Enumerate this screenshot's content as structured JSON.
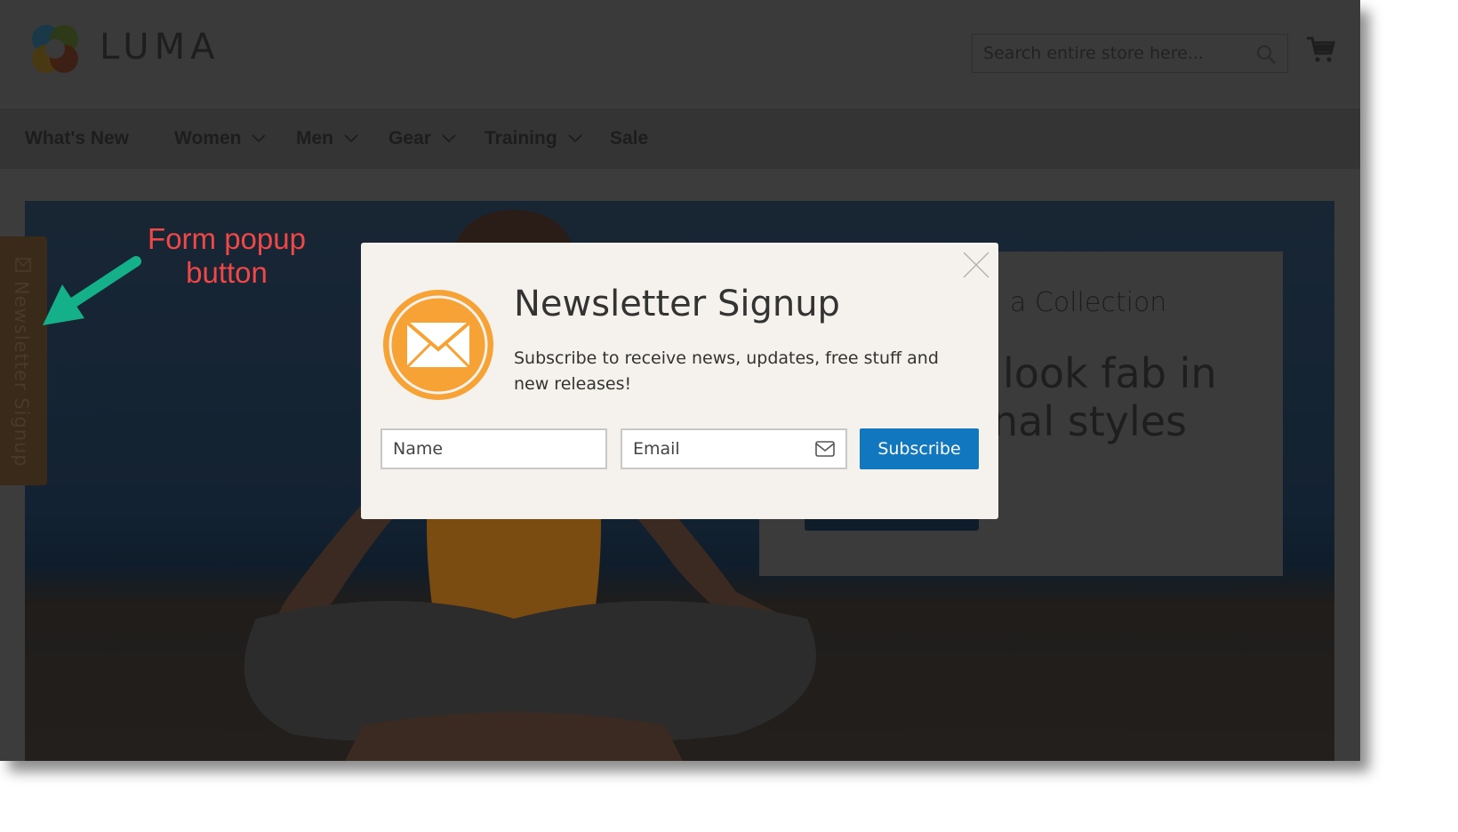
{
  "header": {
    "logo_text": "LUMA",
    "search": {
      "placeholder": "Search entire store here..."
    },
    "icons": {
      "search": "search-icon",
      "cart": "cart-icon"
    }
  },
  "nav": {
    "items": [
      {
        "label": "What's New",
        "has_dropdown": false
      },
      {
        "label": "Women",
        "has_dropdown": true
      },
      {
        "label": "Men",
        "has_dropdown": true
      },
      {
        "label": "Gear",
        "has_dropdown": true
      },
      {
        "label": "Training",
        "has_dropdown": true
      },
      {
        "label": "Sale",
        "has_dropdown": false
      }
    ]
  },
  "hero": {
    "promo_line1": "a Collection",
    "promo_line2a": "look fab in",
    "promo_line2b": "nal styles"
  },
  "side_tab": {
    "label": "Newsletter Signup",
    "icon": "envelope-icon"
  },
  "annotation": {
    "line1": "Form popup",
    "line2": "button",
    "color": "#f04848",
    "arrow_color": "#14b08a"
  },
  "modal": {
    "title": "Newsletter Signup",
    "description": "Subscribe to receive news, updates, free stuff and new releases!",
    "name_placeholder": "Name",
    "email_placeholder": "Email",
    "subscribe_label": "Subscribe",
    "badge_color": "#f7a234",
    "button_color": "#1177bf"
  }
}
